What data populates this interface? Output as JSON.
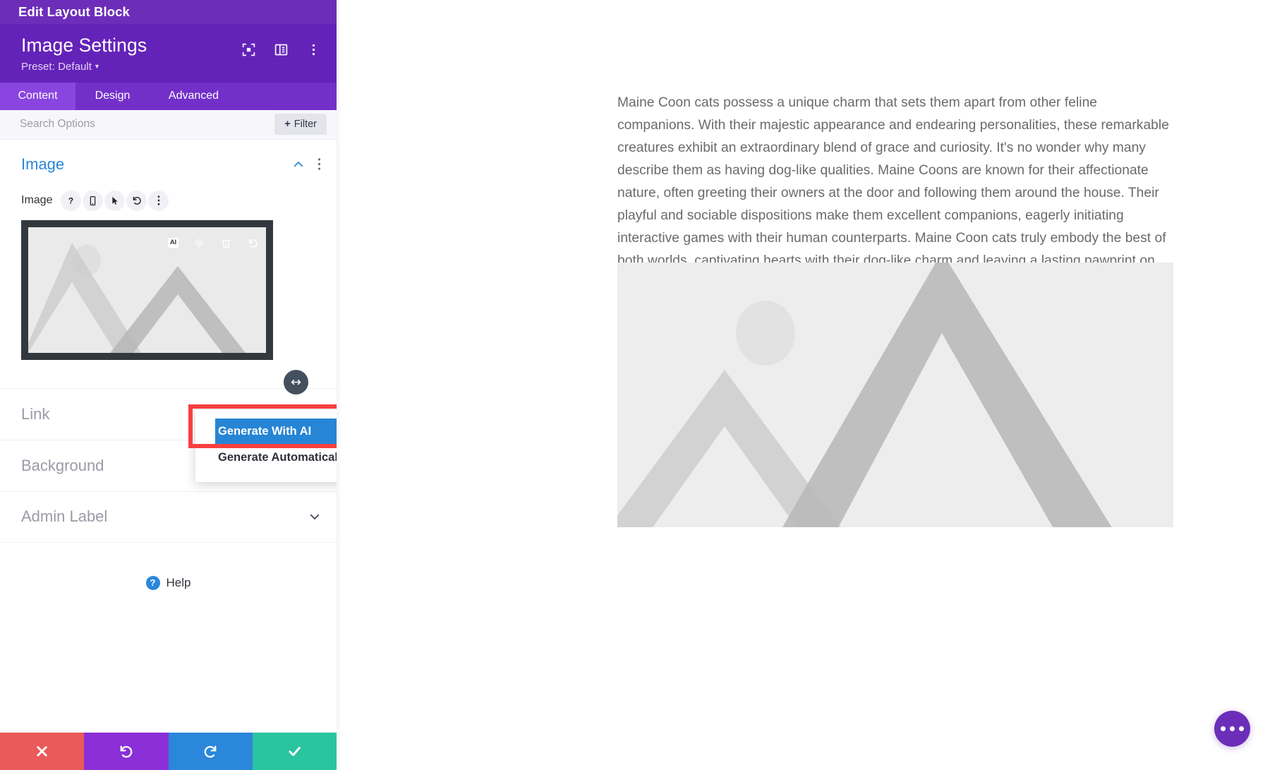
{
  "panel": {
    "titlebar": "Edit Layout Block",
    "header": {
      "title": "Image Settings",
      "preset": "Preset: Default",
      "icons": [
        "focus-mode-icon",
        "panel-layout-icon",
        "more-vertical-icon"
      ]
    },
    "tabs": [
      {
        "label": "Content",
        "active": true
      },
      {
        "label": "Design",
        "active": false
      },
      {
        "label": "Advanced",
        "active": false
      }
    ],
    "search": {
      "value": "",
      "placeholder": "Search Options"
    },
    "filter_button": {
      "plus": "+",
      "label": "Filter"
    },
    "image_section": {
      "title": "Image",
      "field_label": "Image",
      "field_icons": [
        "help-icon",
        "responsive-mobile-icon",
        "hover-cursor-icon",
        "reset-undo-icon",
        "more-vertical-icon"
      ],
      "thumb_toolbar": [
        "ai-icon",
        "settings-gear-icon",
        "delete-trash-icon",
        "reset-undo-icon"
      ],
      "ai_chip_label": "AI"
    },
    "dropdown": {
      "items": [
        {
          "label": "Generate With AI",
          "selected": true
        },
        {
          "label": "Generate Automatically",
          "selected": false
        }
      ]
    },
    "accordion": [
      {
        "label": "Link"
      },
      {
        "label": "Background"
      },
      {
        "label": "Admin Label"
      }
    ],
    "help": {
      "badge": "?",
      "label": "Help"
    },
    "actions": [
      {
        "name": "cancel-button",
        "icon": "close-x-icon",
        "color": "#EB5A5A"
      },
      {
        "name": "undo-button",
        "icon": "undo-icon",
        "color": "#8B2FD6"
      },
      {
        "name": "redo-button",
        "icon": "redo-icon",
        "color": "#2B87DA"
      },
      {
        "name": "save-button",
        "icon": "check-icon",
        "color": "#2BC4A0"
      }
    ]
  },
  "canvas": {
    "paragraph": "Maine Coon cats possess a unique charm that sets them apart from other feline companions. With their majestic appearance and endearing personalities, these remarkable creatures exhibit an extraordinary blend of grace and curiosity. It's no wonder why many describe them as having dog-like qualities. Maine Coons are known for their affectionate nature, often greeting their owners at the door and following them around the house. Their playful and sociable dispositions make them excellent companions, eagerly initiating interactive games with their human counterparts. Maine Coon cats truly embody the best of both worlds, captivating hearts with their dog-like charm and leaving a lasting pawprint on our lives.",
    "image_placeholder_name": "image-placeholder",
    "fab": {
      "icon": "more-horizontal-icon"
    }
  },
  "colors": {
    "panel_header": "#6423B8",
    "titlebar": "#6C2EB9",
    "tabs_bg": "#7230C9",
    "tab_active": "#8A45E0",
    "accent_blue": "#2B87DA",
    "highlight_red": "#F8403F",
    "selected_blue": "#2685D4",
    "thumb_frame": "#33383F"
  }
}
